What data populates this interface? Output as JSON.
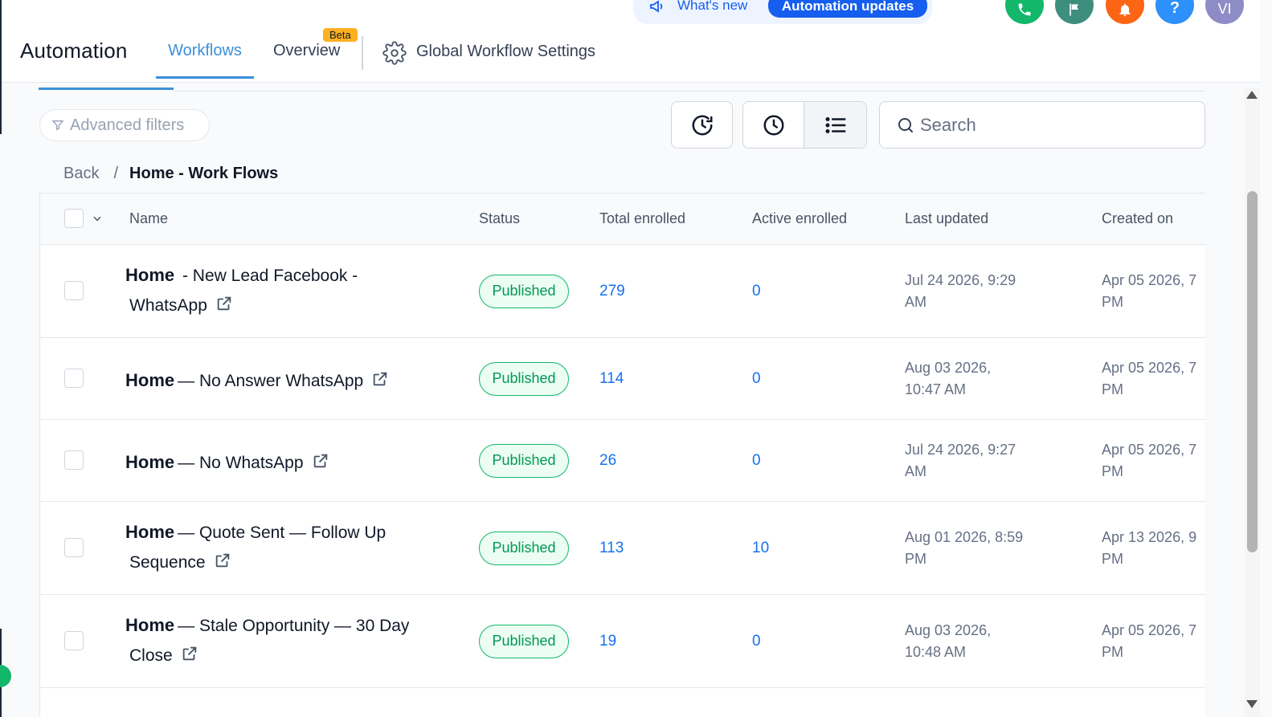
{
  "header": {
    "title": "Automation",
    "tabs": {
      "workflows": "Workflows",
      "overview": "Overview",
      "overview_badge": "Beta",
      "settings": "Global Workflow Settings"
    },
    "announcements": {
      "whats_new": "What's new",
      "updates_button": "Automation updates"
    },
    "avatar_initials": "VI",
    "help_glyph": "?"
  },
  "toolbar": {
    "advanced_filters": "Advanced filters",
    "search_placeholder": "Search"
  },
  "breadcrumb": {
    "back": "Back",
    "separator": "/",
    "current": "Home - Work Flows"
  },
  "table": {
    "columns": [
      "Name",
      "Status",
      "Total enrolled",
      "Active enrolled",
      "Last updated",
      "Created on"
    ],
    "rows": [
      {
        "brand": "Home",
        "name_line1": "- New Lead Facebook -",
        "name_line2": "WhatsApp",
        "status": "Published",
        "total": "279",
        "active": "0",
        "updated_1": "Jul 24 2026, 9:29",
        "updated_2": "AM",
        "created_1": "Apr 05 2026, 7",
        "created_2": "PM"
      },
      {
        "brand": "Home",
        "name_line1": "— No Answer WhatsApp",
        "name_line2": "",
        "status": "Published",
        "total": "114",
        "active": "0",
        "updated_1": "Aug 03 2026,",
        "updated_2": "10:47 AM",
        "created_1": "Apr 05 2026, 7",
        "created_2": "PM"
      },
      {
        "brand": "Home",
        "name_line1": "— No WhatsApp",
        "name_line2": "",
        "status": "Published",
        "total": "26",
        "active": "0",
        "updated_1": "Jul 24 2026, 9:27",
        "updated_2": "AM",
        "created_1": "Apr 05 2026, 7",
        "created_2": "PM"
      },
      {
        "brand": "Home",
        "name_line1": "— Quote Sent — Follow Up",
        "name_line2": "Sequence",
        "status": "Published",
        "total": "113",
        "active": "10",
        "updated_1": "Aug 01 2026, 8:59",
        "updated_2": "PM",
        "created_1": "Apr 13 2026, 9",
        "created_2": "PM"
      },
      {
        "brand": "Home",
        "name_line1": "— Stale Opportunity — 30 Day",
        "name_line2": "Close",
        "status": "Published",
        "total": "19",
        "active": "0",
        "updated_1": "Aug 03 2026,",
        "updated_2": "10:48 AM",
        "created_1": "Apr 05 2026, 7",
        "created_2": "PM"
      }
    ]
  },
  "colors": {
    "accent": "#3b8fd9",
    "primary": "#155eef",
    "success": "#12b76a",
    "link": "#1570ef"
  }
}
